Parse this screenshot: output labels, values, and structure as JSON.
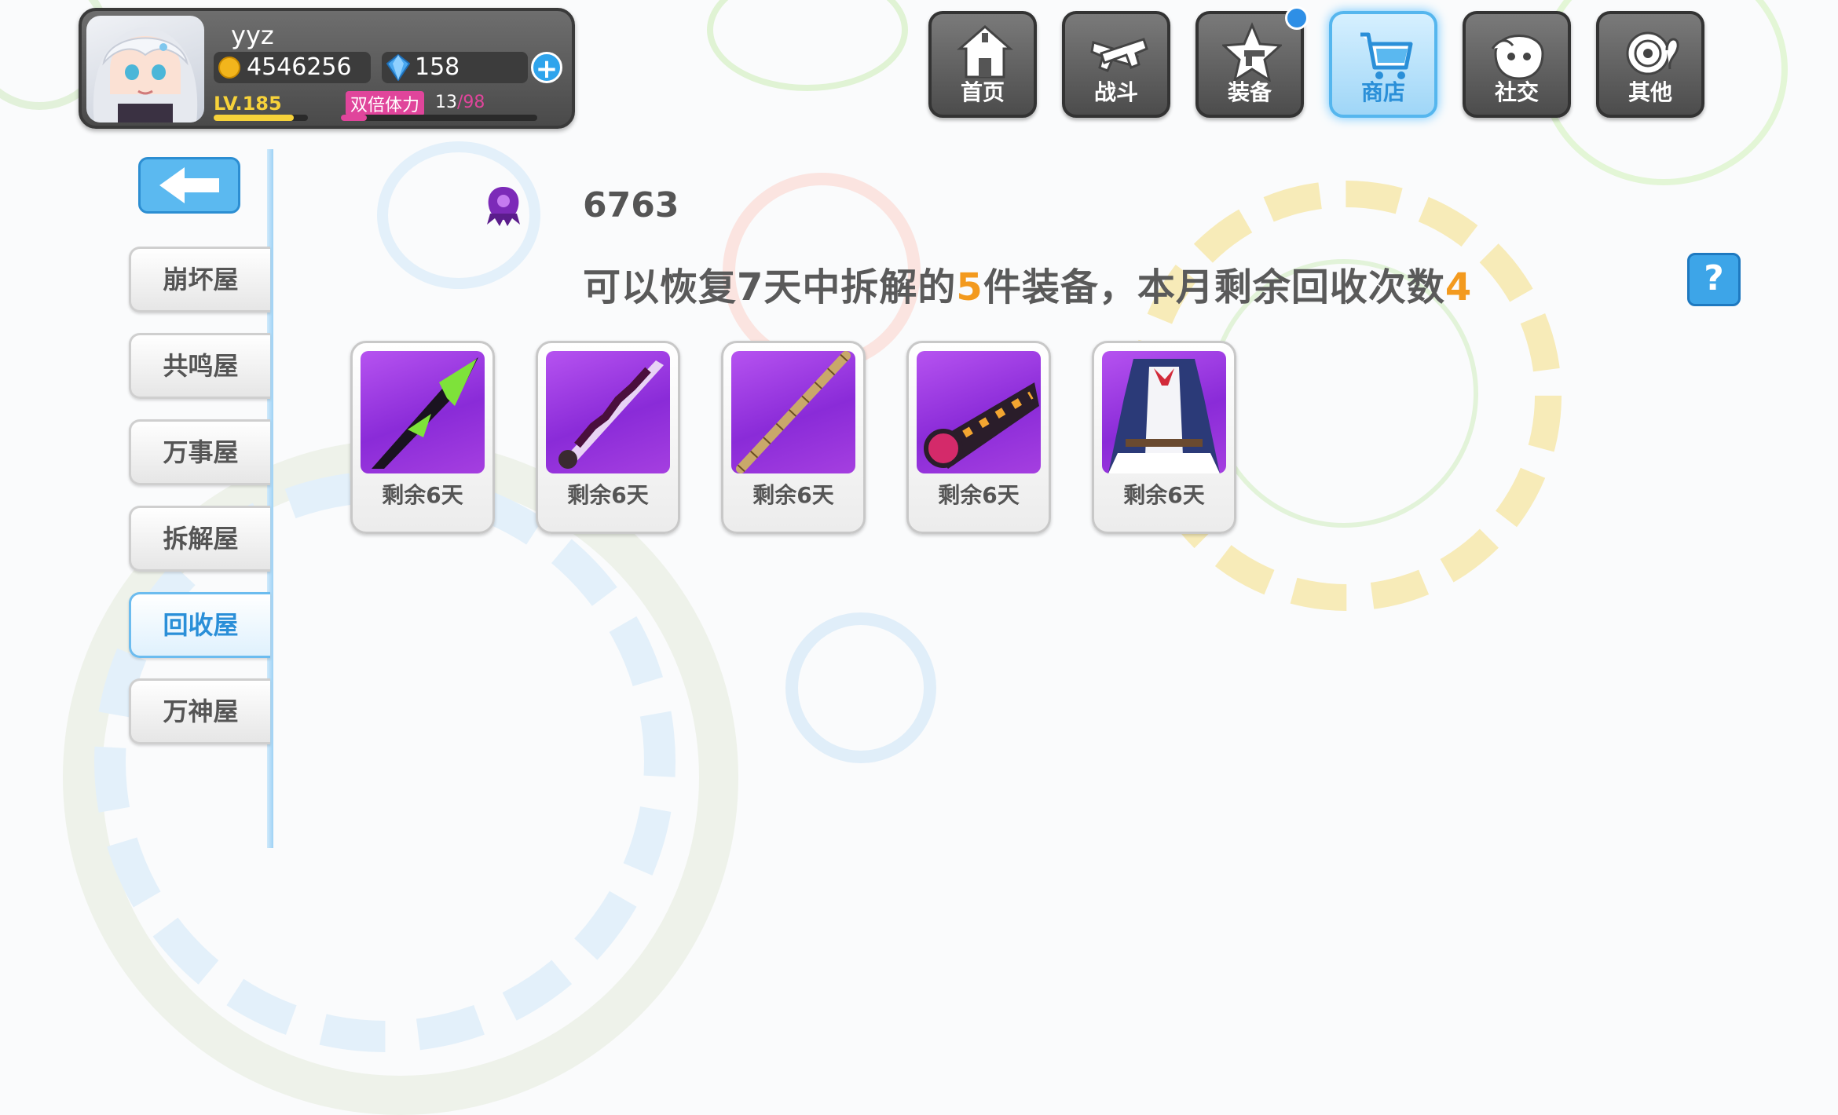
{
  "player": {
    "name": "yyz",
    "coins": "4546256",
    "crystals": "158",
    "level": "LV.185",
    "stamina_label": "双倍体力",
    "stamina_value": "13",
    "stamina_cap": "/98",
    "stamina_fraction": 0.13,
    "level_progress": 0.85
  },
  "nav": {
    "items": [
      {
        "label": "首页"
      },
      {
        "label": "战斗"
      },
      {
        "label": "装备"
      },
      {
        "label": "商店"
      },
      {
        "label": "社交"
      },
      {
        "label": "其他"
      }
    ]
  },
  "sidebar": {
    "items": [
      {
        "label": "崩坏屋"
      },
      {
        "label": "共鸣屋"
      },
      {
        "label": "万事屋"
      },
      {
        "label": "拆解屋"
      },
      {
        "label": "回收屋"
      },
      {
        "label": "万神屋"
      }
    ]
  },
  "main": {
    "currency_value": "6763",
    "info_prefix": "可以恢复7天中拆解的",
    "info_count": "5",
    "info_middle": "件装备，本月剩余回收次数",
    "info_remaining": "4",
    "help_label": "?",
    "items": [
      {
        "label": "剩余6天",
        "icon": "green-scythe-weapon-icon"
      },
      {
        "label": "剩余6天",
        "icon": "chain-sword-weapon-icon"
      },
      {
        "label": "剩余6天",
        "icon": "bamboo-staff-weapon-icon"
      },
      {
        "label": "剩余6天",
        "icon": "chainsaw-weapon-icon"
      },
      {
        "label": "剩余6天",
        "icon": "maid-outfit-costume-icon"
      }
    ]
  },
  "colors": {
    "accent": "#2a8fd8",
    "highlight": "#f39a1e",
    "card_purple": "#9a35dd"
  }
}
